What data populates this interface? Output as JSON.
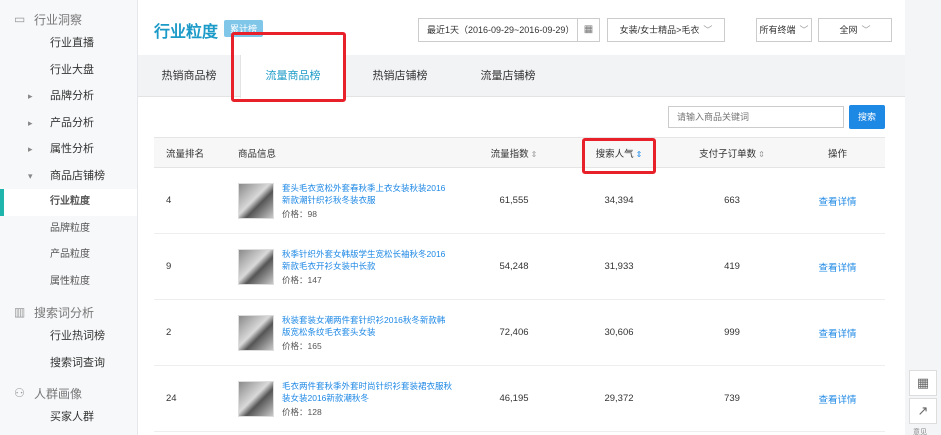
{
  "sidebar": {
    "group_insight": {
      "label": "行业洞察",
      "icon": "monitor-icon"
    },
    "items_top": [
      "行业直播",
      "行业大盘"
    ],
    "items_collapsible": [
      "品牌分析",
      "产品分析",
      "属性分析"
    ],
    "open_item": "商品店铺榜",
    "sub_items": [
      "行业粒度",
      "品牌粒度",
      "产品粒度",
      "属性粒度"
    ],
    "group_search": {
      "label": "搜索词分析",
      "icon": "bar-chart-icon"
    },
    "search_items": [
      "行业热词榜",
      "搜索词查询"
    ],
    "group_crowd": {
      "label": "人群画像",
      "icon": "people-icon"
    },
    "crowd_items": [
      "买家人群"
    ]
  },
  "header": {
    "title": "行业粒度",
    "badge": "累计榜",
    "date_range": "最近1天（2016-09-29~2016-09-29）",
    "category": "女装/女士精品>毛衣",
    "terminal": "所有终端",
    "network": "全网"
  },
  "tabs": [
    "热销商品榜",
    "流量商品榜",
    "热销店铺榜",
    "流量店铺榜"
  ],
  "search": {
    "placeholder": "请输入商品关键词",
    "button": "搜索"
  },
  "table": {
    "headers": {
      "rank": "流量排名",
      "info": "商品信息",
      "traffic": "流量指数",
      "popularity": "搜索人气",
      "orders": "支付子订单数",
      "action": "操作"
    },
    "price_prefix": "价格：",
    "rows": [
      {
        "rank": "4",
        "name": "套头毛衣宽松外套春秋季上衣女装秋装2016新款潮针织衫秋冬装衣服",
        "price": "98",
        "traffic": "61,555",
        "popularity": "34,394",
        "orders": "663",
        "action": "查看详情"
      },
      {
        "rank": "9",
        "name": "秋季针织外套女韩版学生宽松长袖秋冬2016新款毛衣开衫女装中长款",
        "price": "147",
        "traffic": "54,248",
        "popularity": "31,933",
        "orders": "419",
        "action": "查看详情"
      },
      {
        "rank": "2",
        "name": "秋装套装女潮两件套针织衫2016秋冬新款韩版宽松条纹毛衣套头女装",
        "price": "165",
        "traffic": "72,406",
        "popularity": "30,606",
        "orders": "999",
        "action": "查看详情"
      },
      {
        "rank": "24",
        "name": "毛衣两件套秋季外套时尚针织衫套装裙衣服秋装女装2016新款潮秋冬",
        "price": "128",
        "traffic": "46,195",
        "popularity": "29,372",
        "orders": "739",
        "action": "查看详情"
      }
    ]
  },
  "rail": {
    "label": "意见"
  },
  "colors": {
    "accent": "#1d9bc8",
    "link": "#1e88e5",
    "highlight": "#e8202a",
    "active_bar": "#1fb5ad"
  }
}
